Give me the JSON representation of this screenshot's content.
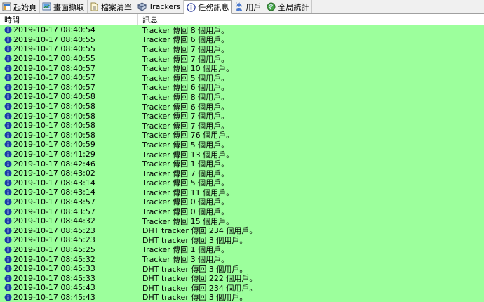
{
  "tabs": [
    {
      "label": "起始頁",
      "icon": "home-icon"
    },
    {
      "label": "畫面擷取",
      "icon": "screenshot-icon"
    },
    {
      "label": "檔案清單",
      "icon": "file-list-icon"
    },
    {
      "label": "Trackers",
      "icon": "trackers-icon"
    },
    {
      "label": "任務訊息",
      "icon": "info-icon",
      "active": true
    },
    {
      "label": "用戶",
      "icon": "peers-icon"
    },
    {
      "label": "全局統計",
      "icon": "stats-icon"
    }
  ],
  "columns": {
    "time": "時間",
    "message": "訊息"
  },
  "row_color": "#9cff9c",
  "rows": [
    {
      "time": "2019-10-17 08:40:54",
      "message": "Tracker 傳回 8 個用戶。"
    },
    {
      "time": "2019-10-17 08:40:55",
      "message": "Tracker 傳回 6 個用戶。"
    },
    {
      "time": "2019-10-17 08:40:55",
      "message": "Tracker 傳回 7 個用戶。"
    },
    {
      "time": "2019-10-17 08:40:55",
      "message": "Tracker 傳回 7 個用戶。"
    },
    {
      "time": "2019-10-17 08:40:57",
      "message": "Tracker 傳回 10 個用戶。"
    },
    {
      "time": "2019-10-17 08:40:57",
      "message": "Tracker 傳回 5 個用戶。"
    },
    {
      "time": "2019-10-17 08:40:57",
      "message": "Tracker 傳回 6 個用戶。"
    },
    {
      "time": "2019-10-17 08:40:58",
      "message": "Tracker 傳回 8 個用戶。"
    },
    {
      "time": "2019-10-17 08:40:58",
      "message": "Tracker 傳回 6 個用戶。"
    },
    {
      "time": "2019-10-17 08:40:58",
      "message": "Tracker 傳回 7 個用戶。"
    },
    {
      "time": "2019-10-17 08:40:58",
      "message": "Tracker 傳回 7 個用戶。"
    },
    {
      "time": "2019-10-17 08:40:58",
      "message": "Tracker 傳回 76 個用戶。"
    },
    {
      "time": "2019-10-17 08:40:59",
      "message": "Tracker 傳回 5 個用戶。"
    },
    {
      "time": "2019-10-17 08:41:29",
      "message": "Tracker 傳回 13 個用戶。"
    },
    {
      "time": "2019-10-17 08:42:46",
      "message": "Tracker 傳回 1 個用戶。"
    },
    {
      "time": "2019-10-17 08:43:02",
      "message": "Tracker 傳回 7 個用戶。"
    },
    {
      "time": "2019-10-17 08:43:14",
      "message": "Tracker 傳回 5 個用戶。"
    },
    {
      "time": "2019-10-17 08:43:14",
      "message": "Tracker 傳回 11 個用戶。"
    },
    {
      "time": "2019-10-17 08:43:57",
      "message": "Tracker 傳回 0 個用戶。"
    },
    {
      "time": "2019-10-17 08:43:57",
      "message": "Tracker 傳回 0 個用戶。"
    },
    {
      "time": "2019-10-17 08:44:32",
      "message": "Tracker 傳回 15 個用戶。"
    },
    {
      "time": "2019-10-17 08:45:23",
      "message": "DHT tracker 傳回 234 個用戶。"
    },
    {
      "time": "2019-10-17 08:45:23",
      "message": "DHT tracker 傳回 3 個用戶。"
    },
    {
      "time": "2019-10-17 08:45:25",
      "message": "Tracker 傳回 1 個用戶。"
    },
    {
      "time": "2019-10-17 08:45:32",
      "message": "Tracker 傳回 3 個用戶。"
    },
    {
      "time": "2019-10-17 08:45:33",
      "message": "DHT tracker 傳回 3 個用戶。"
    },
    {
      "time": "2019-10-17 08:45:33",
      "message": "DHT tracker 傳回 222 個用戶。"
    },
    {
      "time": "2019-10-17 08:45:43",
      "message": "DHT tracker 傳回 234 個用戶。"
    },
    {
      "time": "2019-10-17 08:45:43",
      "message": "DHT tracker 傳回 3 個用戶。"
    }
  ]
}
